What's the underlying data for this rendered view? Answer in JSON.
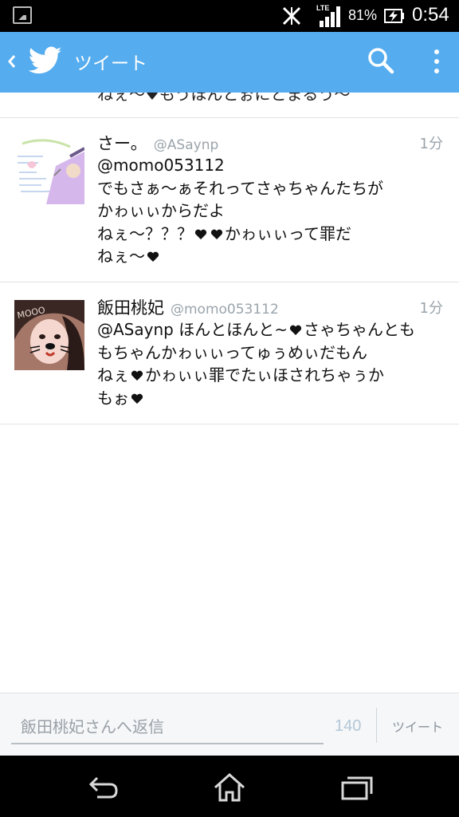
{
  "status_bar": {
    "network": "LTE",
    "battery_percent": "81%",
    "time": "0:54"
  },
  "action_bar": {
    "title": "ツイート",
    "accent_color": "#55acee"
  },
  "partial_tweet": {
    "text": "ねぇ〜♥もうほんとぉにとまるう〜"
  },
  "tweets": [
    {
      "name": "さー。",
      "handle": "@ASaynp",
      "time": "1分",
      "lines": [
        [
          "@momo053112"
        ],
        [
          "でもさぁ〜ぁそれってさゃちゃんたちが"
        ],
        [
          "かゎぃぃからだよ"
        ],
        [
          "ねぇ〜？？？",
          "heart",
          "heart",
          "かゎぃぃって罪だ"
        ],
        [
          "ねぇ〜",
          "heart"
        ]
      ]
    },
    {
      "name": "飯田桃妃",
      "handle": "@momo053112",
      "time": "1分",
      "lines": [
        [
          "@ASaynp ほんとほんと~",
          "heart",
          "さゃちゃんとも"
        ],
        [
          "もちゃんかゎぃぃってゅぅめぃだもん"
        ],
        [
          "ねぇ",
          "heart",
          "かゎぃぃ罪でたぃほされちゃぅか"
        ],
        [
          "もぉ",
          "heart"
        ]
      ]
    }
  ],
  "reply": {
    "placeholder": "飯田桃妃さんへ返信",
    "char_count": "140",
    "button_label": "ツイート"
  },
  "icons": {
    "status": [
      "gallery-icon",
      "mute-icon",
      "signal-icon",
      "battery-charging-icon"
    ],
    "action_bar": [
      "back-icon",
      "twitter-bird-icon",
      "search-icon",
      "overflow-menu-icon"
    ],
    "navigation": [
      "back-nav-icon",
      "home-icon",
      "recent-apps-icon"
    ]
  }
}
